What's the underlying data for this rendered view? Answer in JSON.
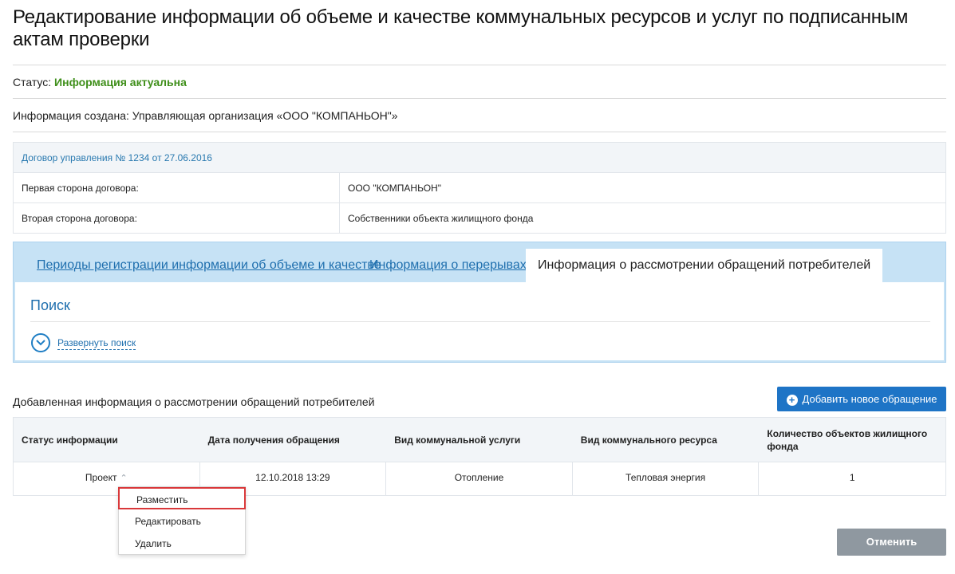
{
  "page": {
    "title": "Редактирование информации об объеме и качестве коммунальных ресурсов и услуг по подписанным актам проверки"
  },
  "status": {
    "label": "Статус: ",
    "value": "Информация актуальна",
    "value_color": "#3f8f1a"
  },
  "created": {
    "text": "Информация создана: Управляющая организация «ООО \"КОМПАНЬОН\"»"
  },
  "contract": {
    "header": "Договор управления № 1234 от 27.06.2016",
    "rows": [
      {
        "key": "Первая сторона договора:",
        "value": "ООО \"КОМПАНЬОН\""
      },
      {
        "key": "Вторая сторона договора:",
        "value": "Собственники объекта жилищного фонда"
      }
    ]
  },
  "tabs": [
    {
      "label": "Периоды регистрации информации об объеме и качестве"
    },
    {
      "label": "Информация о перерывах"
    },
    {
      "label": "Информация о рассмотрении обращений потребителей"
    }
  ],
  "search": {
    "title": "Поиск",
    "expand_label": "Развернуть поиск",
    "icon": "chevron-down-circle-icon"
  },
  "section": {
    "title": "Добавленная информация о рассмотрении обращений потребителей",
    "add_button": "Добавить новое обращение",
    "accent": "#1e74c6"
  },
  "table": {
    "headers": [
      "Статус информации",
      "Дата получения обращения",
      "Вид коммунальной услуги",
      "Вид коммунального ресурса",
      "Количество объектов жилищного фонда"
    ],
    "rows": [
      {
        "status": "Проект",
        "date": "12.10.2018 13:29",
        "service": "Отопление",
        "resource": "Тепловая энергия",
        "count": "1"
      }
    ]
  },
  "context_menu": {
    "items": [
      "Разместить",
      "Редактировать",
      "Удалить"
    ],
    "highlight_color": "#d9383a"
  },
  "footer": {
    "cancel_button": "Отменить"
  }
}
